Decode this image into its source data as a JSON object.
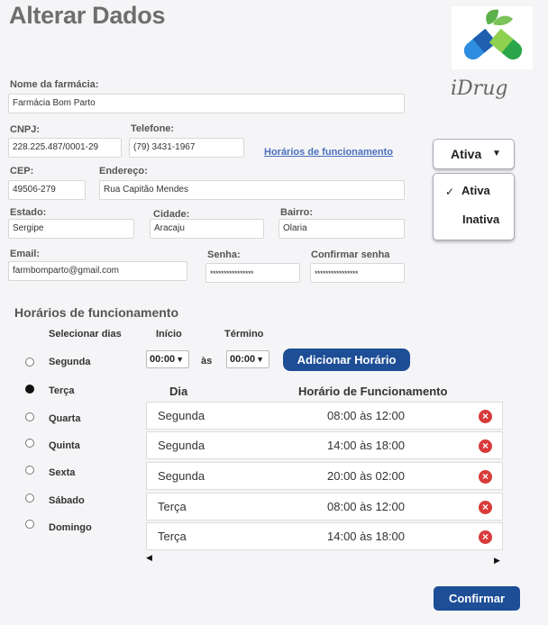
{
  "page": {
    "title": "Alterar Dados"
  },
  "brand": {
    "name": "iDrug"
  },
  "form": {
    "nome_label": "Nome da farmácia:",
    "nome_value": "Farmácia Bom Parto",
    "cnpj_label": "CNPJ:",
    "cnpj_value": "228.225.487/0001-29",
    "telefone_label": "Telefone:",
    "telefone_value": "(79) 3431-1967",
    "horarios_link": "Horários de funcionamento",
    "cep_label": "CEP:",
    "cep_value": "49506-279",
    "endereco_label": "Endereço:",
    "endereco_value": "Rua Capitão Mendes",
    "estado_label": "Estado:",
    "estado_value": "Sergipe",
    "cidade_label": "Cidade:",
    "cidade_value": "Aracaju",
    "bairro_label": "Bairro:",
    "bairro_value": "Olaria",
    "email_label": "Email:",
    "email_value": "farmbomparto@gmail.com",
    "senha_label": "Senha:",
    "senha_value": "****************",
    "confirmar_senha_label": "Confirmar senha",
    "confirmar_senha_value": "****************"
  },
  "status": {
    "selected": "Ativa",
    "options": [
      "Ativa",
      "Inativa"
    ],
    "check": "✓",
    "caret": "▼"
  },
  "schedule": {
    "section_title": "Horários de funcionamento",
    "select_days_label": "Selecionar dias",
    "start_label": "Início",
    "end_label": "Término",
    "start_value": "00:00",
    "end_value": "00:00",
    "between": "às",
    "add_button": "Adicionar Horário",
    "days": [
      "Segunda",
      "Terça",
      "Quarta",
      "Quinta",
      "Sexta",
      "Sábado",
      "Domingo"
    ],
    "selected_day": "Terça",
    "table_headers": {
      "day": "Dia",
      "hours": "Horário de Funcionamento"
    },
    "rows": [
      {
        "day": "Segunda",
        "hours": "08:00 às 12:00"
      },
      {
        "day": "Segunda",
        "hours": "14:00 às 18:00"
      },
      {
        "day": "Segunda",
        "hours": "20:00 às 02:00"
      },
      {
        "day": "Terça",
        "hours": "08:00 às 12:00"
      },
      {
        "day": "Terça",
        "hours": "14:00 às 18:00"
      }
    ]
  },
  "confirm_button": "Confirmar",
  "colors": {
    "primary": "#1d4e96",
    "delete": "#d83a3a",
    "link": "#4a6fbf"
  }
}
